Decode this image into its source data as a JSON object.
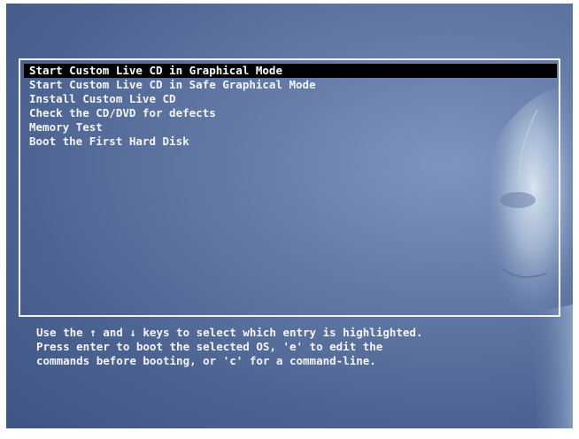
{
  "boot_menu": {
    "items": [
      {
        "label": "Start Custom Live CD in Graphical Mode",
        "selected": true
      },
      {
        "label": "Start Custom Live CD in Safe Graphical Mode",
        "selected": false
      },
      {
        "label": "Install Custom Live CD",
        "selected": false
      },
      {
        "label": "Check the CD/DVD for defects",
        "selected": false
      },
      {
        "label": "Memory Test",
        "selected": false
      },
      {
        "label": "Boot the First Hard Disk",
        "selected": false
      }
    ]
  },
  "help_text": {
    "line1": "Use the ↑ and ↓ keys to select which entry is highlighted.",
    "line2": "Press enter to boot the selected OS, 'e' to edit the",
    "line3": "commands before booting, or 'c' for a command-line."
  },
  "colors": {
    "background": "#5a6f9c",
    "text": "#f4f4f4",
    "highlight": "#000000"
  },
  "background_art": "robot-face-icon"
}
